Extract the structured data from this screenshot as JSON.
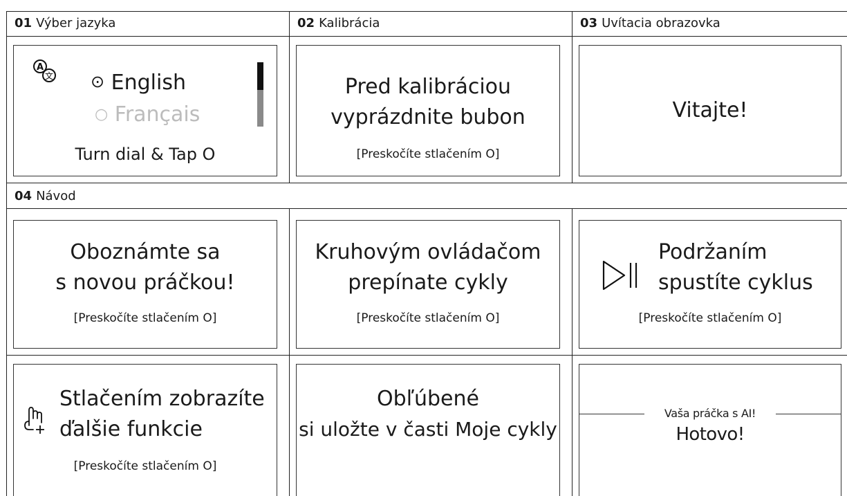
{
  "sections": {
    "s01": {
      "num": "01",
      "title": "Výber jazyka"
    },
    "s02": {
      "num": "02",
      "title": "Kalibrácia"
    },
    "s03": {
      "num": "03",
      "title": "Uvítacia obrazovka"
    },
    "s04": {
      "num": "04",
      "title": "Návod"
    }
  },
  "language_screen": {
    "option_selected_marker": "⊙",
    "option_selected": "English",
    "option_unselected_marker": "○",
    "option_unselected": "Français",
    "instruction": "Turn dial & Tap O",
    "icon": "translate-icon"
  },
  "calibration_screen": {
    "line1": "Pred kalibráciou",
    "line2": "vyprázdnite bubon",
    "skip": "[Preskočíte stlačením O]"
  },
  "welcome_screen": {
    "text": "Vitajte!"
  },
  "tutorial": {
    "screen1": {
      "line1": "Oboznámte sa",
      "line2": "s novou práčkou!",
      "skip": "[Preskočíte stlačením O]"
    },
    "screen2": {
      "line1": "Kruhovým ovládačom",
      "line2": "prepínate cykly",
      "skip": "[Preskočíte stlačením O]"
    },
    "screen3": {
      "icon": "play-pause-icon",
      "line1": "Podržaním",
      "line2": "spustíte cyklus",
      "skip": "[Preskočíte stlačením O]"
    },
    "screen4": {
      "icon": "press-hand-icon",
      "line1": "Stlačením zobrazíte",
      "line2": "ďalšie funkcie",
      "skip": "[Preskočíte stlačením O]"
    },
    "screen5": {
      "line1": "Obľúbené",
      "line2": "si uložte v časti Moje cykly"
    },
    "screen6": {
      "subtitle": "Vaša práčka s AI!",
      "text": "Hotovo!"
    }
  }
}
